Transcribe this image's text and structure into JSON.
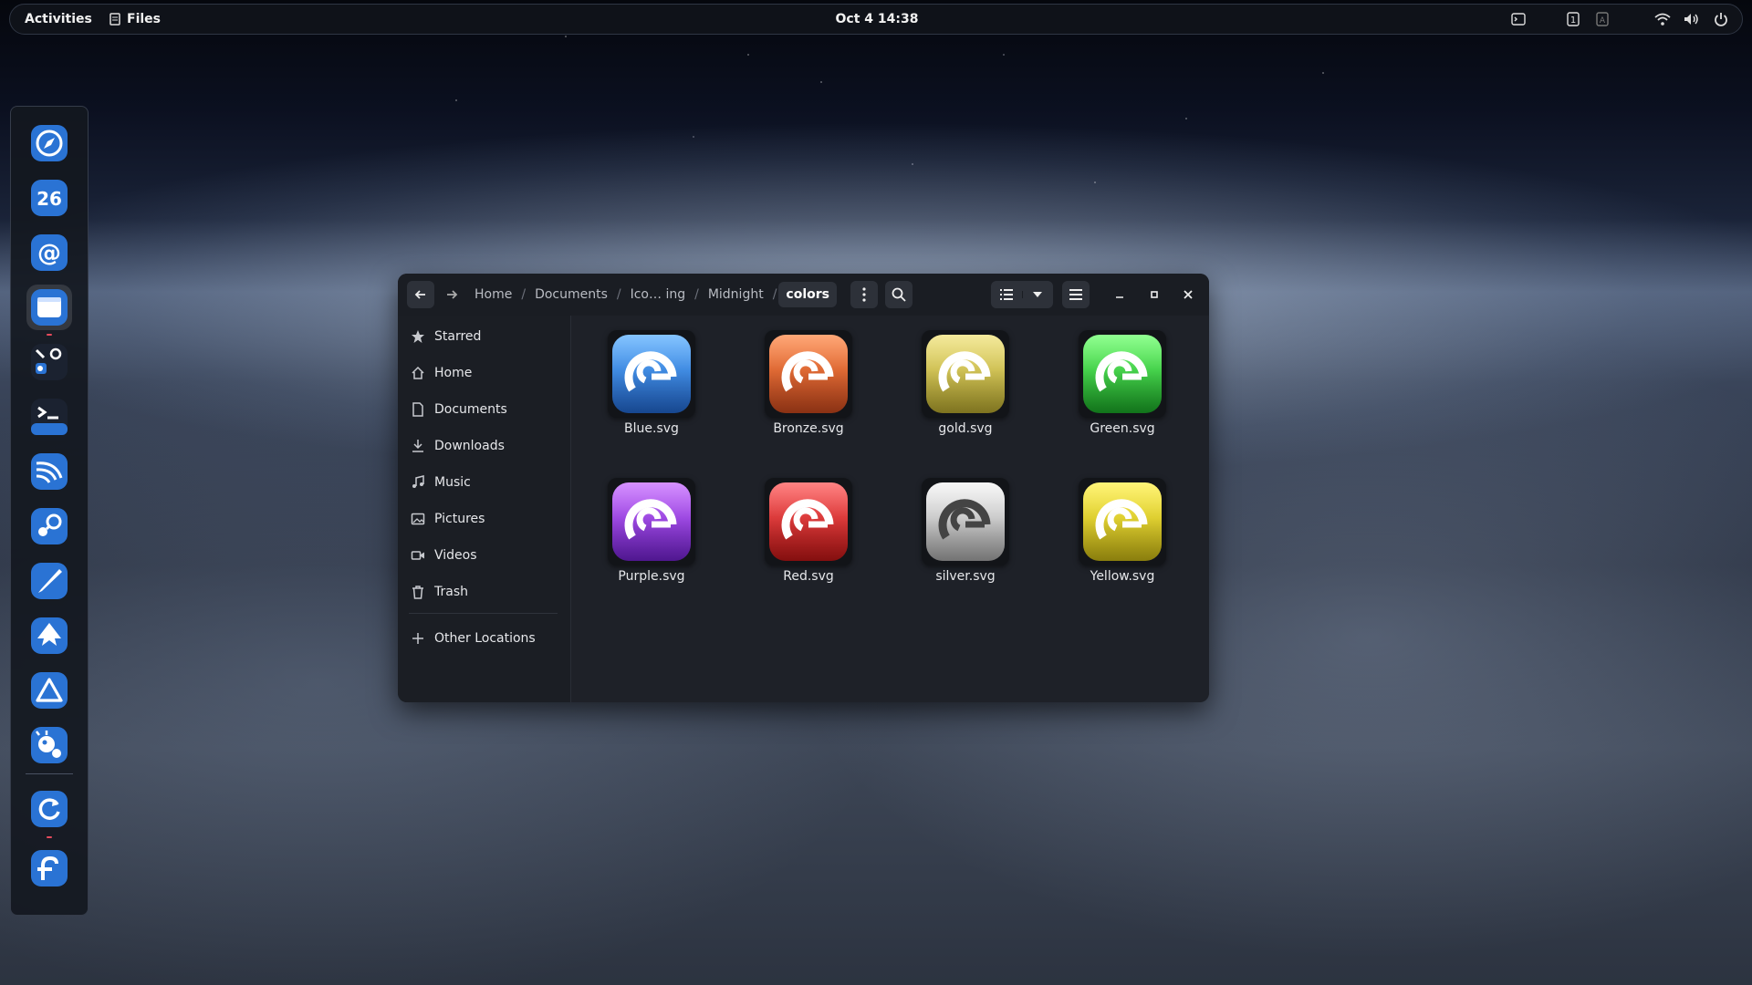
{
  "topbar": {
    "activities": "Activities",
    "app_name": "Files",
    "clock": "Oct 4  14:38",
    "tray_icons": [
      "terminal-icon",
      "workspace-indicator-icon",
      "keyboard-layout-icon",
      "wifi-icon",
      "volume-icon",
      "power-icon"
    ]
  },
  "dock": {
    "apps": [
      {
        "name": "browser",
        "icon": "compass-icon",
        "color": "#3f7fcf"
      },
      {
        "name": "calendar",
        "icon": "calendar-icon",
        "label": "26",
        "color": "#2f7ad6"
      },
      {
        "name": "mail",
        "icon": "at-sign-icon",
        "color": "#2f7ad6"
      },
      {
        "name": "files",
        "icon": "folder-window-icon",
        "color": "#2f7ad6"
      },
      {
        "name": "settings",
        "icon": "settings-cluster-icon",
        "color": "#2f7ad6"
      },
      {
        "name": "terminal",
        "icon": "terminal-icon",
        "color": "#2f7ad6"
      },
      {
        "name": "rss-reader",
        "icon": "feed-icon",
        "color": "#2f7ad6"
      },
      {
        "name": "steam",
        "icon": "steam-icon",
        "color": "#2f7ad6"
      },
      {
        "name": "drawing",
        "icon": "brush-icon",
        "color": "#2f7ad6"
      },
      {
        "name": "inkscape",
        "icon": "inkscape-icon",
        "color": "#2f7ad6"
      },
      {
        "name": "vector-app",
        "icon": "delta-icon",
        "color": "#2f7ad6"
      },
      {
        "name": "gimp",
        "icon": "paint-icon",
        "color": "#2f7ad6"
      },
      {
        "name": "backup",
        "icon": "refresh-icon",
        "color": "#2f7ad6"
      },
      {
        "name": "fedora",
        "icon": "fedora-icon",
        "color": "#2f7ad6"
      }
    ]
  },
  "window": {
    "breadcrumbs": [
      "Home",
      "Documents",
      "Ico… ing",
      "Midnight",
      "colors"
    ],
    "current_folder": "colors",
    "sidebar": [
      {
        "label": "Starred",
        "icon": "star-icon"
      },
      {
        "label": "Home",
        "icon": "home-icon"
      },
      {
        "label": "Documents",
        "icon": "document-icon"
      },
      {
        "label": "Downloads",
        "icon": "download-icon"
      },
      {
        "label": "Music",
        "icon": "music-icon"
      },
      {
        "label": "Pictures",
        "icon": "picture-icon"
      },
      {
        "label": "Videos",
        "icon": "video-icon"
      },
      {
        "label": "Trash",
        "icon": "trash-icon"
      }
    ],
    "other_locations": "Other Locations",
    "files": [
      {
        "name": "Blue.svg",
        "top": "#5cb0ff",
        "bottom": "#1f5fbf"
      },
      {
        "name": "Bronze.svg",
        "top": "#ff8a4a",
        "bottom": "#b8421a"
      },
      {
        "name": "gold.svg",
        "top": "#f0e27a",
        "bottom": "#a89a2a"
      },
      {
        "name": "Green.svg",
        "top": "#6cff6c",
        "bottom": "#189a24"
      },
      {
        "name": "Purple.svg",
        "top": "#c86cff",
        "bottom": "#6a1fbf"
      },
      {
        "name": "Red.svg",
        "top": "#ff5a5a",
        "bottom": "#b01414"
      },
      {
        "name": "silver.svg",
        "top": "#f4f4f4",
        "bottom": "#9a9a9a"
      },
      {
        "name": "Yellow.svg",
        "top": "#fff04a",
        "bottom": "#b8a812"
      }
    ]
  }
}
